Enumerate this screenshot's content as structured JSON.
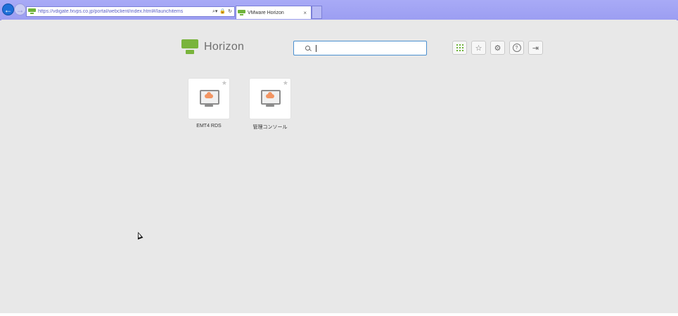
{
  "browser": {
    "url": "https://vdigate.fxvps.co.jp/portal/webclient/index.html#/launchitems",
    "url_icons": [
      "search-dropdown-icon",
      "lock-icon",
      "refresh-icon"
    ],
    "tab_title": "VMware Horizon",
    "tab_close": "×"
  },
  "header": {
    "logo_text": "Horizon",
    "search_placeholder": "",
    "search_value": ""
  },
  "toolbar": {
    "icons": [
      "apps-grid-icon",
      "favorites-star-icon",
      "settings-gear-icon",
      "help-icon",
      "logout-icon"
    ],
    "favorites_glyph": "☆",
    "settings_glyph": "⚙",
    "help_glyph": "?",
    "logout_glyph": "⇥"
  },
  "apps": [
    {
      "label": "EMT4 RDS",
      "star": "★"
    },
    {
      "label": "管理コンソール",
      "star": "★"
    }
  ],
  "colors": {
    "brand_green": "#79b43c",
    "accent_blue": "#4a8fcf",
    "cloud_orange": "#f29563",
    "chrome_purple": "#a8aaf6"
  }
}
